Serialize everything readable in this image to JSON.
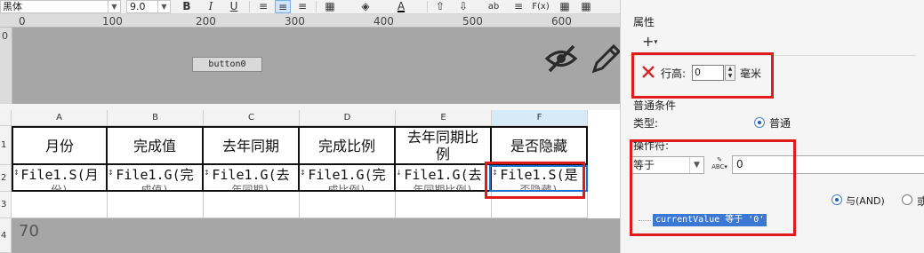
{
  "toolbar": {
    "font_name": "黑体",
    "font_size": "9.0",
    "bold": "B",
    "italic": "I",
    "underline": "U",
    "align_left": "≡",
    "align_center": "≡",
    "align_right": "≡",
    "borders": "▦",
    "fill": "◈",
    "font_color": "A",
    "vertical_align": "⇧",
    "wrap": "ab",
    "merge": "≡",
    "function": "F(x)",
    "more": "▦"
  },
  "ruler": {
    "marks": [
      "0",
      "100",
      "200",
      "300",
      "400",
      "500",
      "600"
    ],
    "vertical_mark": "0"
  },
  "canvas": {
    "button_label": "button0"
  },
  "sheet": {
    "columns": [
      "A",
      "B",
      "C",
      "D",
      "E",
      "F"
    ],
    "rows": [
      "1",
      "2",
      "3",
      "4"
    ],
    "headers": [
      "月份",
      "完成值",
      "去年同期",
      "完成比例",
      "去年同期比例",
      "是否隐藏"
    ],
    "data": [
      "File1.S(月",
      "File1.G(完",
      "File1.G(去",
      "File1.G(完",
      "File1.G(去",
      "File1.S(是"
    ],
    "data_sub": [
      "份)",
      "成值)",
      "年同期)",
      "成比例)",
      "年同期比例)",
      "否隐藏)"
    ],
    "overlay_number": "70"
  },
  "panel": {
    "section_title": "属性",
    "add_label": "+",
    "row_height_label": "行高:",
    "row_height_value": "0",
    "row_height_unit": "毫米",
    "normal_condition_label": "普通条件",
    "type_label": "类型:",
    "type_value": "普通",
    "operator_label": "操作符:",
    "operator_value": "等于",
    "operand_value": "0",
    "and_label": "与(AND)",
    "or_label": "或",
    "condition_text": "currentValue 等于 '0'"
  },
  "colors": {
    "highlight_red": "#e01b1b",
    "selection_blue": "#1f6fd1",
    "condition_bg": "#3a78d4",
    "canvas_gray": "#a6a6a6"
  }
}
